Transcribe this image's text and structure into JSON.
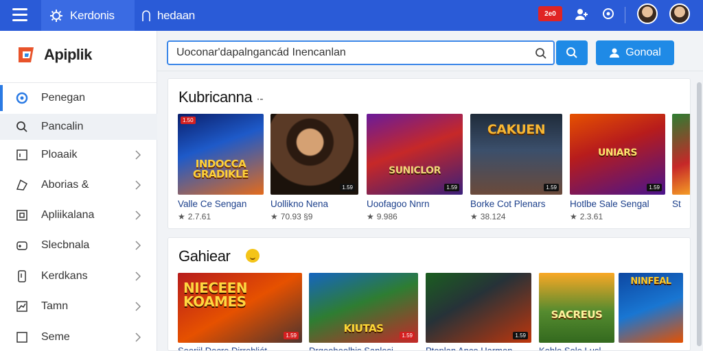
{
  "topbar": {
    "tab_active": "Kerdonis",
    "tab_second": "hedaan",
    "badge": "2e0",
    "bg": "#2a5bd7",
    "icons": [
      "menu-icon",
      "settings-icon",
      "user-icon",
      "person-add-icon",
      "help-icon"
    ]
  },
  "sidebar": {
    "logo": "Apiplik",
    "items": [
      {
        "label": "Penegan",
        "icon": "compass-icon",
        "state": "active"
      },
      {
        "label": "Pancalin",
        "icon": "search-icon",
        "state": "hover"
      },
      {
        "label": "Ploaaik",
        "icon": "app-icon",
        "state": ""
      },
      {
        "label": "Aborias &",
        "icon": "tag-icon",
        "state": ""
      },
      {
        "label": "Apliikalana",
        "icon": "grid-icon",
        "state": ""
      },
      {
        "label": "Slecbnala",
        "icon": "gamepad-icon",
        "state": ""
      },
      {
        "label": "Kerdkans",
        "icon": "phone-icon",
        "state": ""
      },
      {
        "label": "Tamn",
        "icon": "chart-icon",
        "state": ""
      },
      {
        "label": "Seme",
        "icon": "square-icon",
        "state": ""
      }
    ]
  },
  "search": {
    "value": "Uoconar'dapalngancád Inencanlan",
    "button": "Gonoal"
  },
  "section1": {
    "title": "Kubricanna",
    "suffix": "·‑",
    "cards": [
      {
        "title": "Valle Ce Sengan",
        "meta": "2.7.61",
        "tag": "1.59",
        "art": "INDOCCA\nGRADIKLE"
      },
      {
        "title": "Uollikno Nena",
        "meta": "70.93 §9",
        "tag": "1.59",
        "art": ""
      },
      {
        "title": "Uoofagoo Nnrn",
        "meta": "9.986",
        "tag": "1.59",
        "art": "SUNICLOR"
      },
      {
        "title": "Borke Cot Plenars",
        "meta": "38.124",
        "tag": "1.59",
        "art": "CAKUEN"
      },
      {
        "title": "Hotlbe Sale Sengal",
        "meta": "2.3.61",
        "tag": "1.59",
        "art": "UNIARS"
      },
      {
        "title": "St",
        "meta": "",
        "tag": "",
        "art": ""
      }
    ]
  },
  "section2": {
    "title": "Gahiear",
    "cards": [
      {
        "title": "Sooriil Decre Dirrebliét",
        "tag": "1.59",
        "art": "NIECEEN\nKOAMES"
      },
      {
        "title": "Drgeohoolhis Sanlesi",
        "tag": "1.59",
        "art": "KIUTAS"
      },
      {
        "title": "Ptoplan Anco Harmen",
        "tag": "1.59",
        "art": ""
      },
      {
        "title": "Kohle Sole Lusl",
        "tag": "",
        "art": "SACREUS"
      },
      {
        "title": "",
        "tag": "",
        "art": "NINFEAL"
      }
    ]
  }
}
